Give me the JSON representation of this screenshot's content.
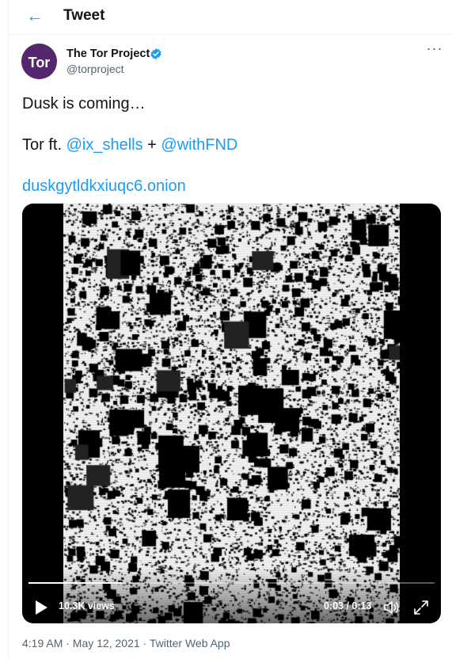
{
  "header": {
    "back_icon": "arrow-left-icon",
    "title": "Tweet"
  },
  "author": {
    "name": "The Tor Project",
    "handle": "@torproject",
    "avatar_text": "Tor",
    "verified_icon": "verified-badge-icon",
    "avatar_color": "#55276f"
  },
  "tweet": {
    "line1": "Dusk is coming…",
    "line2_prefix": "Tor ft. ",
    "mention1": "@ix_shells",
    "joiner": " + ",
    "mention2": "@withFND",
    "link": "duskgytldkxiuqc6.onion"
  },
  "video": {
    "views": "10.3K views",
    "time": "0:03 / 0:13",
    "progress": 0.23,
    "play_icon": "play-icon",
    "volume_icon": "volume-icon",
    "fullscreen_icon": "fullscreen-icon"
  },
  "meta": {
    "timestamp": "4:19 AM · May 12, 2021 · Twitter Web App"
  },
  "colors": {
    "accent": "#1d9bf0",
    "text": "#0f1419",
    "secondary": "#536471"
  }
}
